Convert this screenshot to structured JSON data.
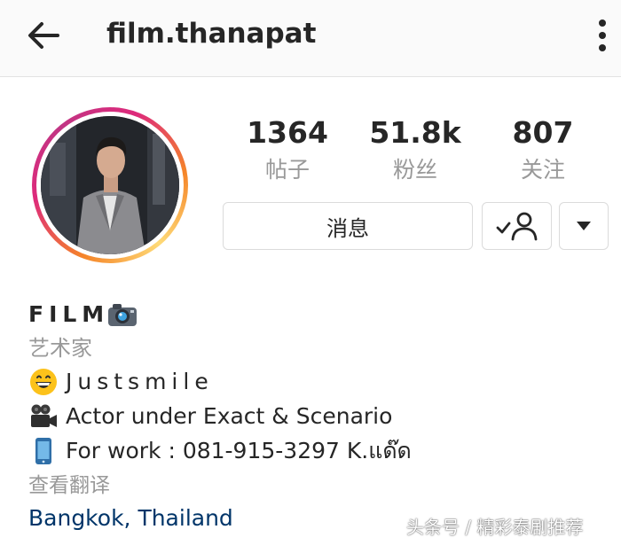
{
  "header": {
    "username": "film.thanapat",
    "back_icon": "arrow-left-icon",
    "more_icon": "vertical-ellipsis-icon"
  },
  "stats": {
    "posts": {
      "value": "1364",
      "label": "帖子"
    },
    "followers": {
      "value": "51.8k",
      "label": "粉丝"
    },
    "following": {
      "value": "807",
      "label": "关注"
    }
  },
  "actions": {
    "message_label": "消息",
    "following_icon": "person-check-icon",
    "dropdown_icon": "caret-down-icon"
  },
  "bio": {
    "display_name": "FILM",
    "display_name_icon": "camera-icon",
    "category": "艺术家",
    "lines": [
      {
        "icon": "grinning-face-icon",
        "text": "Justsmile"
      },
      {
        "icon": "movie-camera-icon",
        "text": "Actor under Exact & Scenario"
      },
      {
        "icon": "mobile-phone-icon",
        "text": "For work : 081-915-3297 K.แด๊ด"
      }
    ],
    "translate_label": "查看翻译",
    "location": "Bangkok, Thailand"
  },
  "watermark": "头条号 / 精彩泰剧推荐",
  "colors": {
    "link": "#003569",
    "muted": "#999999",
    "ring_start": "#f58529",
    "ring_end": "#c13584"
  }
}
